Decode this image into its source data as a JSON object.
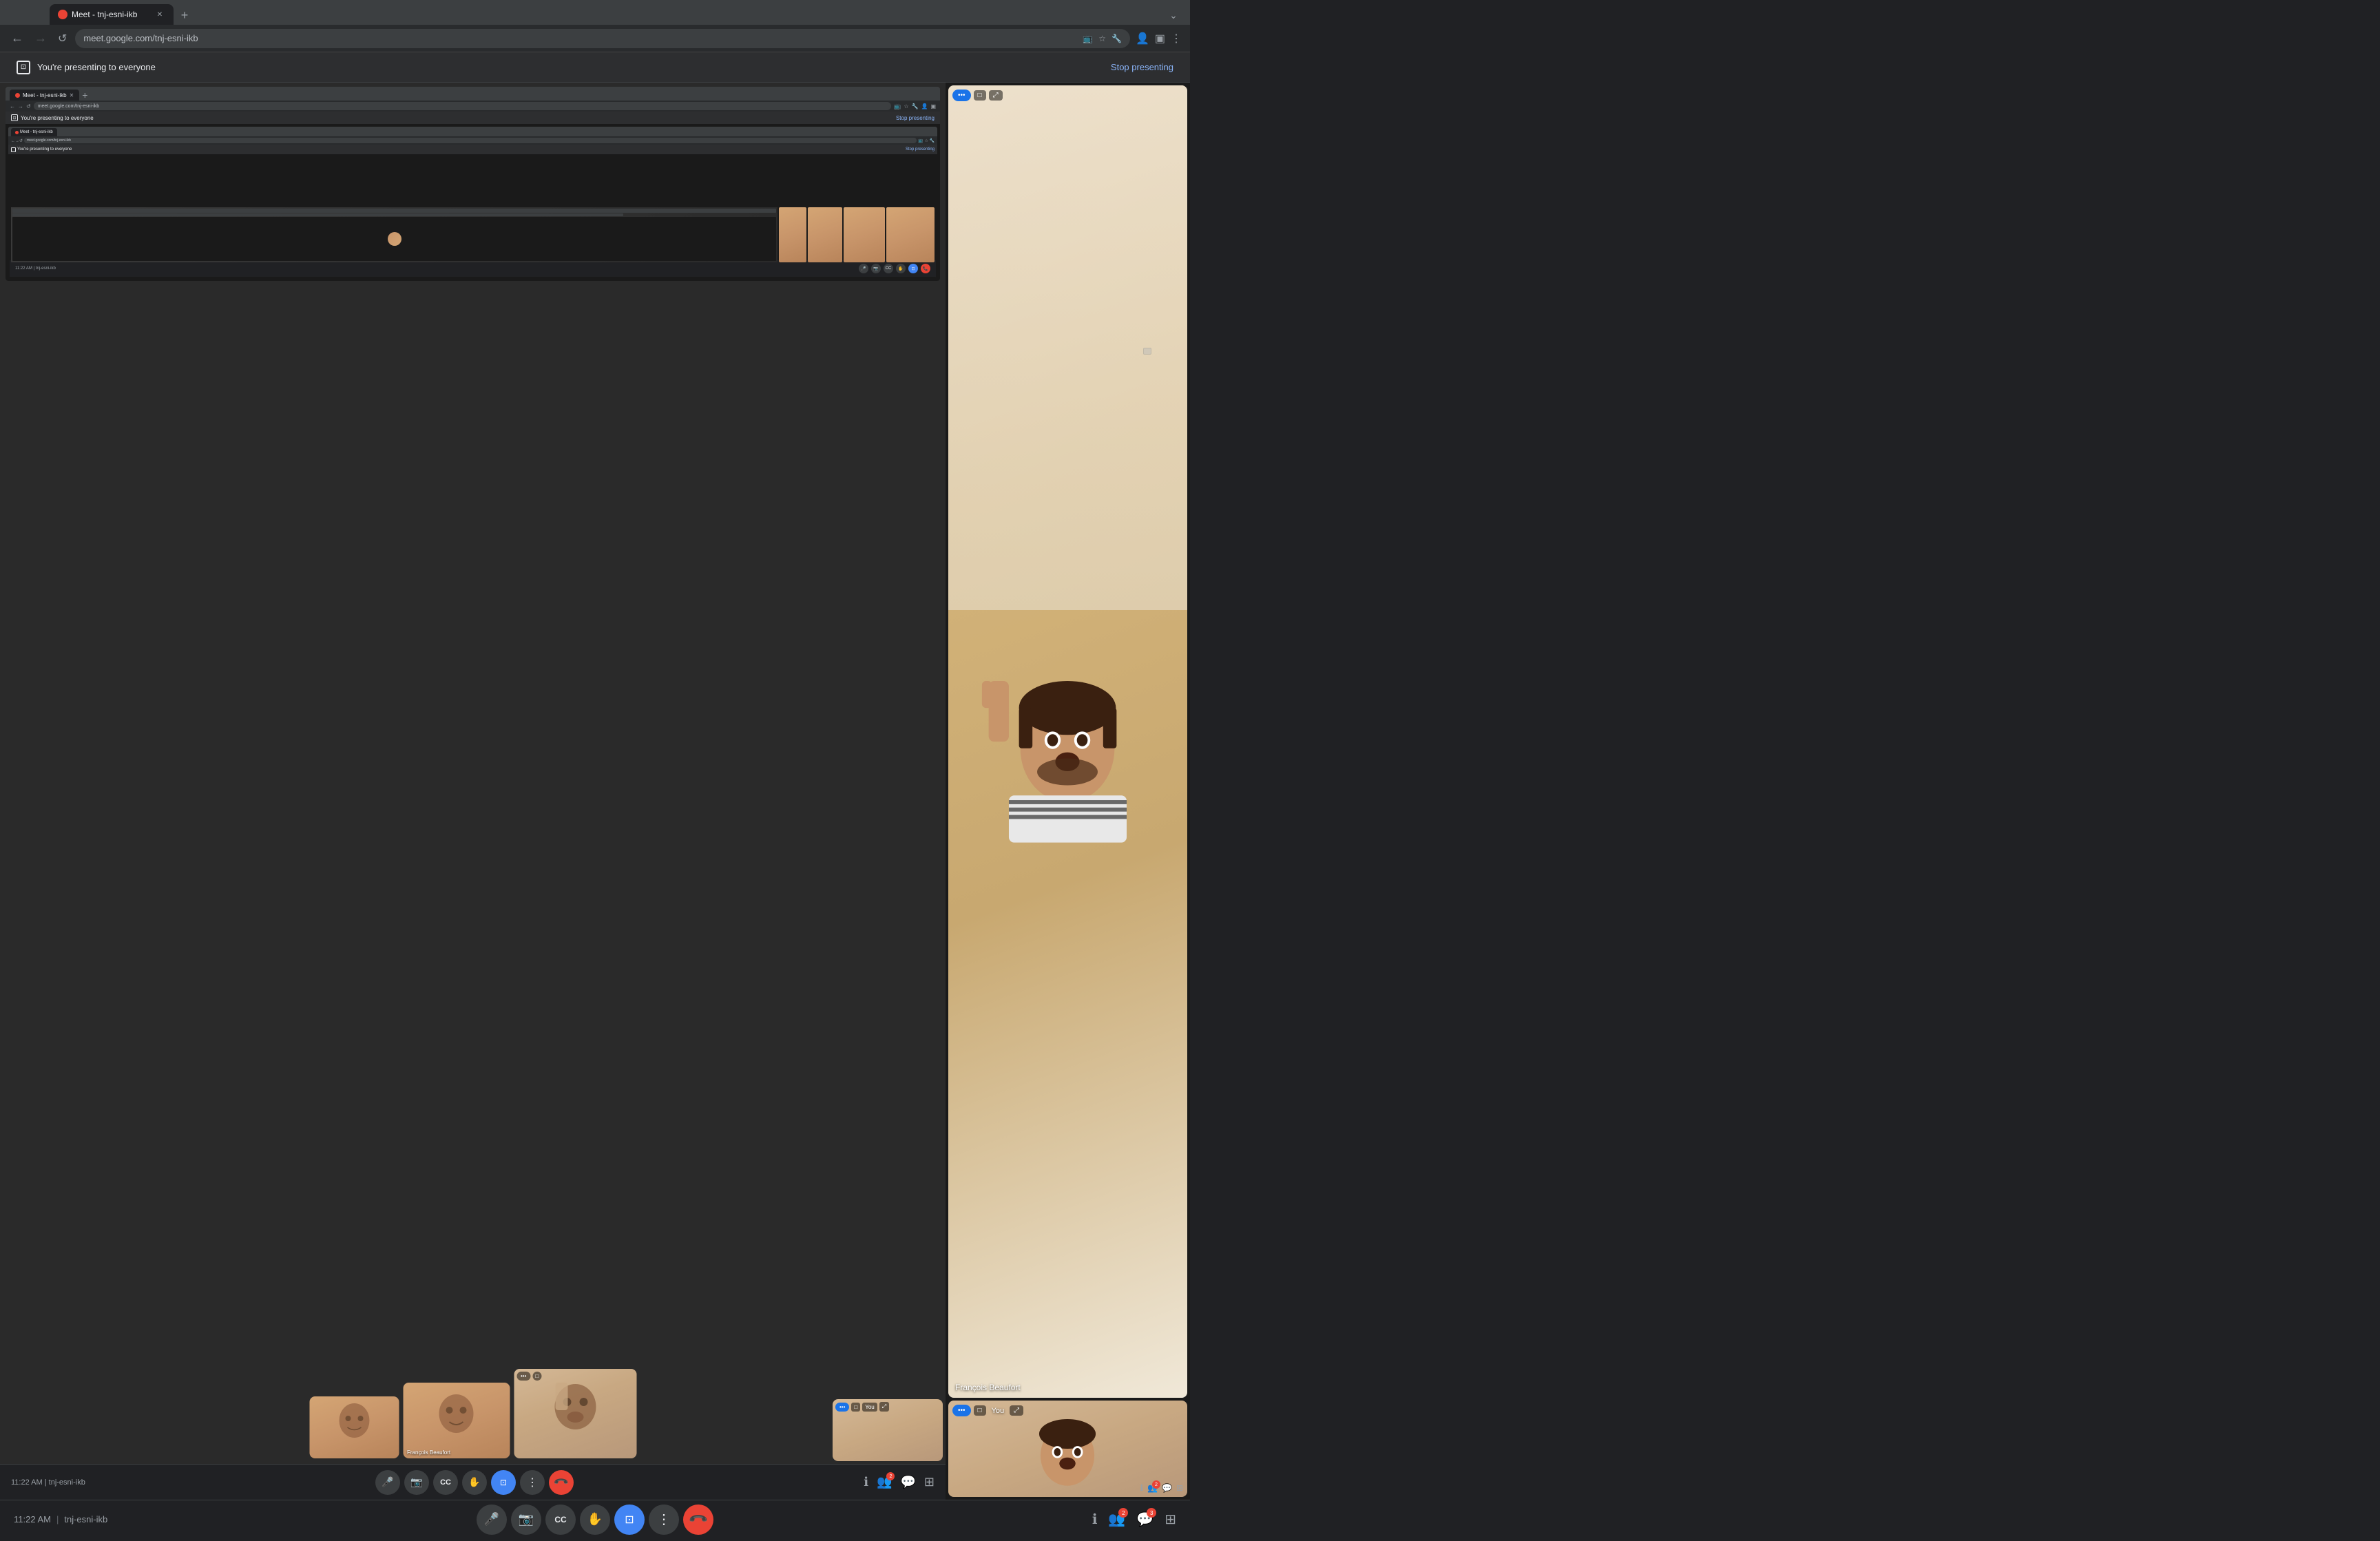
{
  "browser": {
    "tab_title": "Meet - tnj-esni-ikb",
    "favicon_color": "#ea4335",
    "url": "meet.google.com/tnj-esni-ikb",
    "new_tab_label": "+",
    "nav_back": "←",
    "nav_forward": "→",
    "nav_refresh": "↺"
  },
  "banner": {
    "text": "You're presenting to everyone",
    "stop_label": "Stop presenting"
  },
  "nested_browser": {
    "tab_title": "Meet - tnj-esni-ikb",
    "url": "meet.google.com/tnj-esni-ikb",
    "banner_text": "You're presenting to everyone",
    "stop_label": "Stop presenting"
  },
  "participants": [
    {
      "name": "François Beaufort",
      "is_you": false
    },
    {
      "name": "François Beaufort",
      "is_you": false
    },
    {
      "name": "You",
      "is_you": true
    }
  ],
  "toolbar": {
    "time": "11:22 AM",
    "meeting_code": "tnj-esni-ikb",
    "mic_label": "mic",
    "camera_label": "camera",
    "captions_label": "captions",
    "raise_hand_label": "raise hand",
    "share_screen_label": "share screen",
    "more_label": "more",
    "end_call_label": "end call",
    "info_label": "info",
    "people_label": "people",
    "chat_label": "chat",
    "activities_label": "activities"
  },
  "right_panel": {
    "participant_name": "François Beaufort",
    "you_label": "You",
    "dots": "•••"
  },
  "icons": {
    "mic": "🎤",
    "camera": "📷",
    "captions": "CC",
    "raise_hand": "✋",
    "share_screen": "⊡",
    "more": "⋮",
    "end_call": "📞",
    "info": "ℹ",
    "people": "👥",
    "chat": "💬",
    "activities": "⊞",
    "present": "⊡",
    "expand": "⤢",
    "pip": "□"
  },
  "badges": {
    "people_count": "2",
    "chat_count": "3"
  }
}
